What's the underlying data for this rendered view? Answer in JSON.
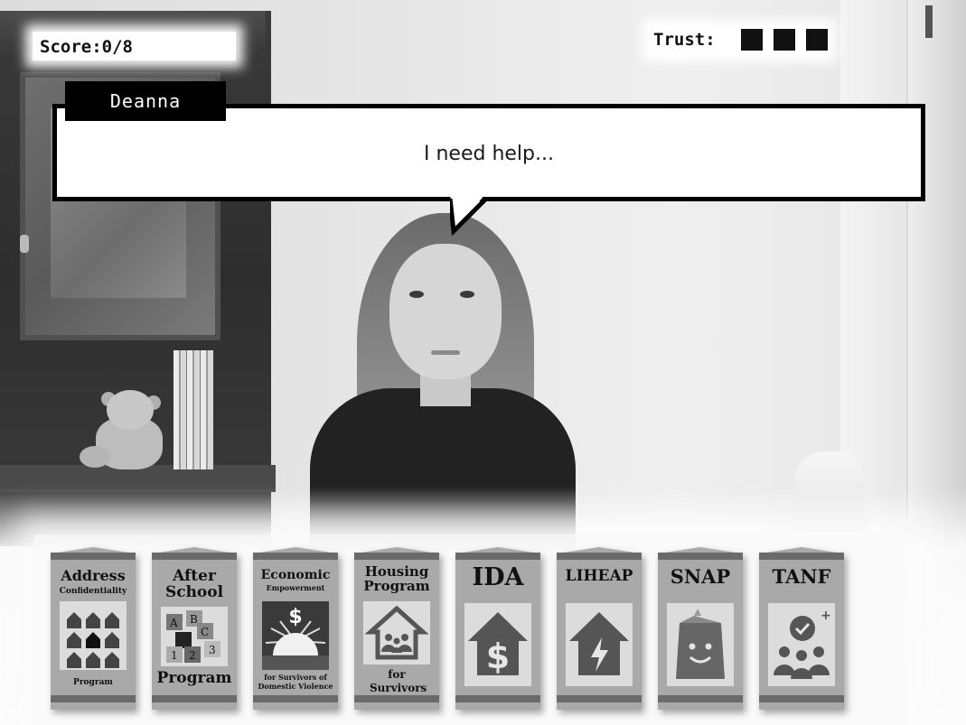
{
  "hud": {
    "score_text": "Score:0/8",
    "trust_label": "Trust:",
    "trust_level": 3,
    "trust_max": 3
  },
  "dialogue": {
    "speaker": "Deanna",
    "text": "I need help..."
  },
  "brochures": [
    {
      "title": "Address",
      "subtitle": "Confidentiality",
      "footer": "Program",
      "icon": "houses-grid-icon"
    },
    {
      "title": "After School",
      "subtitle": "",
      "footer": "Program",
      "icon": "abc-blocks-icon"
    },
    {
      "title": "Economic",
      "subtitle": "Empowerment",
      "footer": "for Survivors of Domestic Violence",
      "icon": "dollar-sunrise-icon"
    },
    {
      "title": "Housing Program",
      "subtitle": "",
      "footer": "for Survivors",
      "icon": "house-family-icon"
    },
    {
      "title": "IDA",
      "subtitle": "",
      "footer": "",
      "icon": "house-dollar-icon"
    },
    {
      "title": "LIHEAP",
      "subtitle": "",
      "footer": "",
      "icon": "house-lightning-icon"
    },
    {
      "title": "SNAP",
      "subtitle": "",
      "footer": "",
      "icon": "grocery-bag-icon"
    },
    {
      "title": "TANF",
      "subtitle": "",
      "footer": "",
      "icon": "family-check-icon"
    }
  ],
  "colors": {
    "hud_background": "#ffffff",
    "bubble_border": "#000000",
    "brochure_body": "#a9a9a9",
    "brochure_band": "#6a6a6a"
  }
}
